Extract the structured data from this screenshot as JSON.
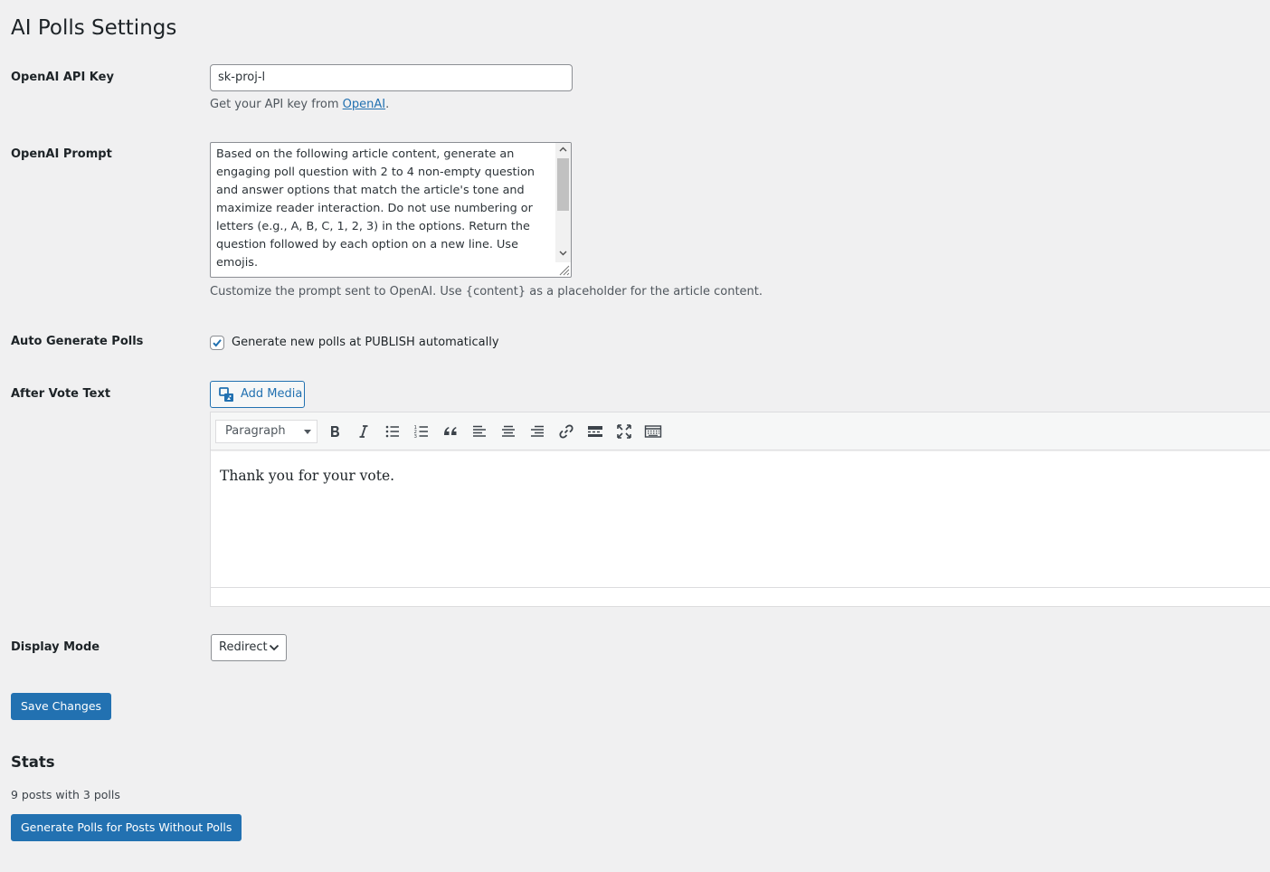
{
  "page": {
    "title": "AI Polls Settings"
  },
  "api_key": {
    "label": "OpenAI API Key",
    "value": "sk-proj-l",
    "help_prefix": "Get your API key from ",
    "help_link": "OpenAI",
    "help_suffix": "."
  },
  "prompt": {
    "label": "OpenAI Prompt",
    "value": "Based on the following article content, generate an engaging poll question with 2 to 4 non-empty question and answer options that match the article's tone and maximize reader interaction. Do not use numbering or letters (e.g., A, B, C, 1, 2, 3) in the options. Return the question followed by each option on a new line. Use emojis.",
    "help": "Customize the prompt sent to OpenAI. Use {content} as a placeholder for the article content."
  },
  "auto_generate": {
    "label": "Auto Generate Polls",
    "checkbox_label": "Generate new polls at PUBLISH automatically",
    "checked": true
  },
  "after_vote": {
    "label": "After Vote Text",
    "add_media_label": "Add Media",
    "format_value": "Paragraph",
    "content": "Thank you for your vote.",
    "toolbar_icons": [
      "bold-icon",
      "italic-icon",
      "bullet-list-icon",
      "numbered-list-icon",
      "blockquote-icon",
      "align-left-icon",
      "align-center-icon",
      "align-right-icon",
      "link-icon",
      "read-more-icon",
      "fullscreen-icon",
      "toolbar-toggle-icon"
    ]
  },
  "display_mode": {
    "label": "Display Mode",
    "selected": "Redirect"
  },
  "save": {
    "label": "Save Changes"
  },
  "stats": {
    "title": "Stats",
    "summary": "9 posts with 3 polls",
    "generate_label": "Generate Polls for Posts Without Polls"
  },
  "colors": {
    "primary": "#2271b1",
    "background": "#f0f0f1",
    "text": "#1d2327"
  }
}
